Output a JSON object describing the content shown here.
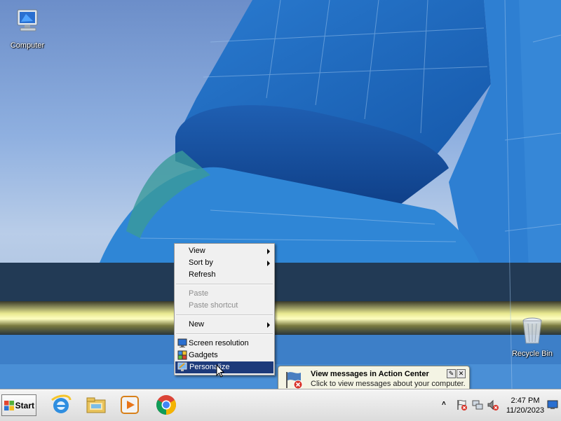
{
  "desktop": {
    "icons": [
      {
        "label": "Computer"
      },
      {
        "label": "Recycle Bin"
      }
    ]
  },
  "context_menu": {
    "items": {
      "view": "View",
      "sort_by": "Sort by",
      "refresh": "Refresh",
      "paste": "Paste",
      "paste_shortcut": "Paste shortcut",
      "new": "New",
      "screen_resolution": "Screen resolution",
      "gadgets": "Gadgets",
      "personalize": "Personalize"
    },
    "selected": "Personalize"
  },
  "balloon": {
    "title": "View messages in Action Center",
    "message": "Click to view messages about your computer."
  },
  "taskbar": {
    "start_label": "Start",
    "pinned": [
      "internet-explorer-icon",
      "windows-explorer-icon",
      "media-player-icon",
      "chrome-icon"
    ],
    "clock": {
      "time": "2:47 PM",
      "date": "11/20/2023"
    }
  },
  "colors": {
    "menu_highlight": "#1d3a7a",
    "balloon_bg": "#f4f4e4"
  }
}
